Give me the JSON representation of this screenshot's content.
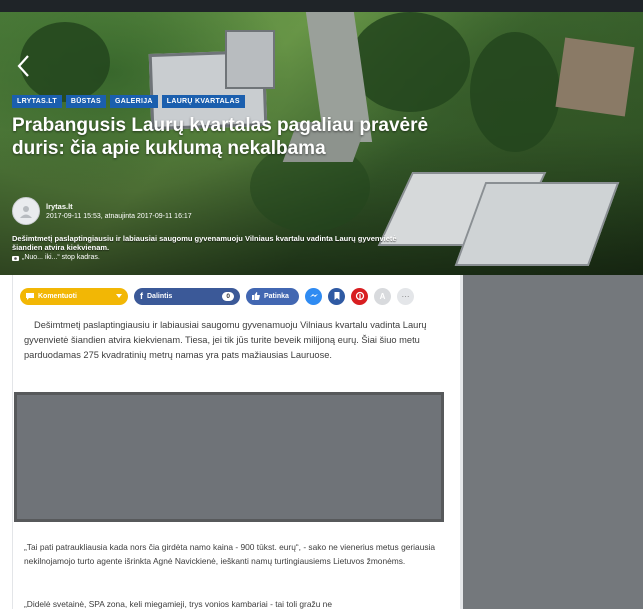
{
  "hero": {
    "back_icon": "chevron-left-icon",
    "tags": [
      "LRYTAS.LT",
      "BŪSTAS",
      "GALERIJA",
      "LAURŲ KVARTALAS"
    ],
    "title": "Prabangusis Laurų kvartalas pagaliau pravėrė duris: čia apie kuklumą nekalbama",
    "author": "lrytas.lt",
    "dates": "2017-09-11 15:53, atnaujinta 2017-09-11 16:17",
    "caption": "Dešimtmetį paslaptingiausiu ir labiausiai saugomu gyvenamuoju Vilniaus kvartalu vadinta Laurų gyvenvietė šiandien atvira kiekvienam.",
    "photo_credit": "„Nuo... iki...“ stop kadras."
  },
  "share_bar": {
    "comment_label": "Komentuoti",
    "facebook_share_label": "Dalintis",
    "facebook_share_count": "0",
    "facebook_like_label": "Patinka",
    "text_size_label": "A",
    "more_label": "···",
    "colors": {
      "comment": "#f2b705",
      "facebook": "#3b5998",
      "messenger": "#2f8bf2",
      "pinterest": "#d81e21"
    }
  },
  "article": {
    "paragraph1": "Dešimtmetį paslaptingiausiu ir labiausiai saugomu gyvenamuoju Vilniaus kvartalu vadinta Laurų gyvenvietė šiandien atvira kiekvienam. Tiesa, jei tik jūs turite beveik milijoną eurų. Šiai šiuo metu parduodamas 275 kvadratinių metrų namas yra pats mažiausias Lauruose.",
    "paragraph2": "„Tai pati patraukliausia kada nors čia girdėta namo kaina - 900 tūkst. eurų“, - sako ne vienerius metus geriausia nekilnojamojo turto agente išrinkta Agnė Navickienė, ieškanti namų turtingiausiems Lietuvos žmonėms.",
    "paragraph3": "„Didelė svetainė, SPA zona, keli miegamieji, trys vonios kambariai - tai toli gražu ne"
  }
}
